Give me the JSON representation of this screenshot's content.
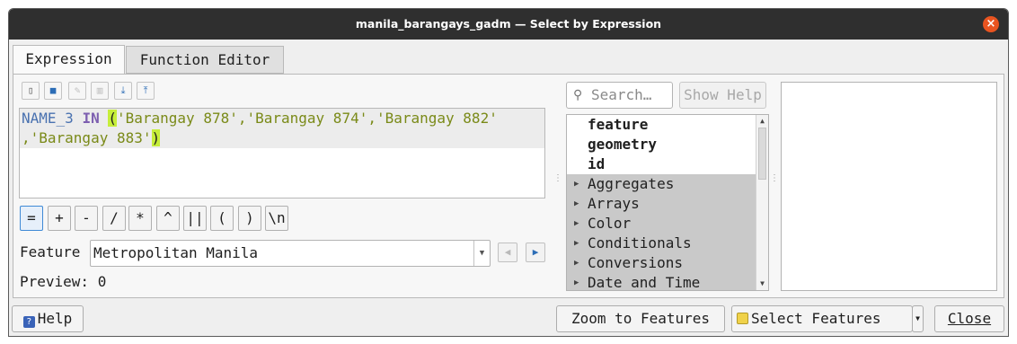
{
  "window": {
    "title": "manila_barangays_gadm — Select by Expression"
  },
  "tabs": {
    "expression": "Expression",
    "function_editor": "Function Editor"
  },
  "toolbar": [
    "new-file-icon",
    "save-icon",
    "edit-icon",
    "delete-icon",
    "import-icon",
    "export-icon"
  ],
  "editor": {
    "field": "NAME_3",
    "operator": "IN",
    "open_paren": "(",
    "line1_strings": "'Barangay 878','Barangay 874','Barangay 882'",
    "line2_strings": ",'Barangay 883'",
    "close_paren": ")"
  },
  "operators": [
    "=",
    "+",
    "-",
    "/",
    "*",
    "^",
    "||",
    "(",
    ")",
    "\\n"
  ],
  "feature": {
    "label": "Feature",
    "value": "Metropolitan Manila"
  },
  "preview": {
    "label": "Preview:",
    "value": "0"
  },
  "search": {
    "placeholder": "Search…"
  },
  "show_help": "Show Help",
  "tree": {
    "fields": [
      "feature",
      "geometry",
      "id"
    ],
    "groups": [
      "Aggregates",
      "Arrays",
      "Color",
      "Conditionals",
      "Conversions",
      "Date and Time"
    ]
  },
  "buttons": {
    "help": "Help",
    "zoom": "Zoom to Features",
    "select": "Select Features",
    "close": "Close"
  },
  "colors": {
    "titlebar": "#2f2f2f",
    "close_button": "#e95420",
    "paren_highlight": "#c6ee3a"
  }
}
